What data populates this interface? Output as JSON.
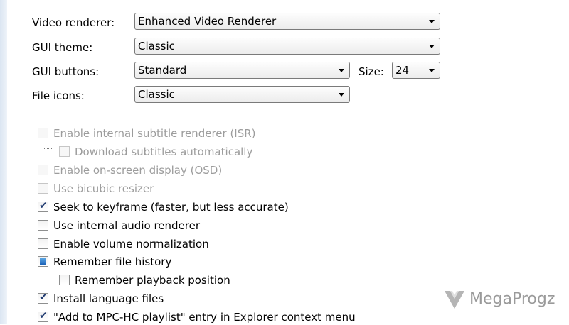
{
  "fields": {
    "video_renderer": {
      "label": "Video renderer:",
      "value": "Enhanced Video Renderer"
    },
    "gui_theme": {
      "label": "GUI theme:",
      "value": "Classic"
    },
    "gui_buttons": {
      "label": "GUI buttons:",
      "value": "Standard"
    },
    "size": {
      "label": "Size:",
      "value": "24"
    },
    "file_icons": {
      "label": "File icons:",
      "value": "Classic"
    }
  },
  "checkboxes": [
    {
      "label": "Enable internal subtitle renderer (ISR)",
      "checked": false,
      "enabled": false
    },
    {
      "label": "Download subtitles automatically",
      "checked": false,
      "enabled": false
    },
    {
      "label": "Enable on-screen display (OSD)",
      "checked": false,
      "enabled": false
    },
    {
      "label": "Use bicubic resizer",
      "checked": false,
      "enabled": false
    },
    {
      "label": "Seek to keyframe (faster, but less accurate)",
      "checked": true,
      "enabled": true
    },
    {
      "label": "Use internal audio renderer",
      "checked": false,
      "enabled": true
    },
    {
      "label": "Enable volume normalization",
      "checked": false,
      "enabled": true
    },
    {
      "label": "Remember file history",
      "checked": "indeterminate",
      "enabled": true
    },
    {
      "label": "Remember playback position",
      "checked": false,
      "enabled": true
    },
    {
      "label": "Install language files",
      "checked": true,
      "enabled": true
    },
    {
      "label": "\"Add to MPC-HC playlist\" entry in Explorer context menu",
      "checked": true,
      "enabled": true
    }
  ],
  "watermark": {
    "text": "MegaProgz",
    "icon": "megaprogz-logo-icon"
  }
}
